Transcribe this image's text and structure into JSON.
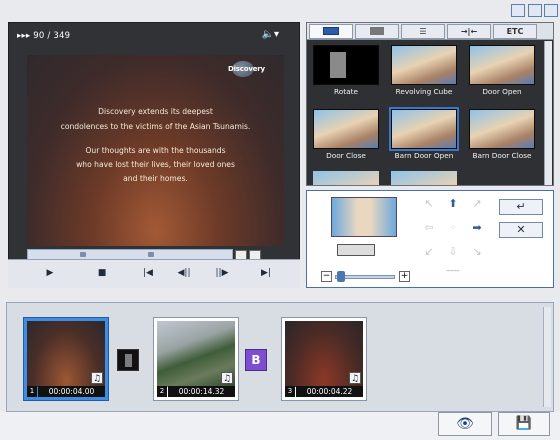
{
  "preview": {
    "frame_counter": "▸▸▸ 90 / 349",
    "video_lines": [
      "Discovery extends its deepest",
      "condolences to the victims of the Asian Tsunamis.",
      "Our thoughts are with the thousands",
      "who have lost their lives, their loved ones",
      "and their homes."
    ],
    "logo_text": "Discovery"
  },
  "effects": {
    "tabs": [
      "",
      "",
      "",
      "",
      "ETC"
    ],
    "items": [
      {
        "label": "Rotate",
        "thumb": "black"
      },
      {
        "label": "Revolving Cube",
        "thumb": "photo"
      },
      {
        "label": "Door Open",
        "thumb": "photo"
      },
      {
        "label": "Door Close",
        "thumb": "photo"
      },
      {
        "label": "Barn Door Open",
        "thumb": "photo-selected"
      },
      {
        "label": "Barn Door Close",
        "thumb": "photo"
      }
    ]
  },
  "storyboard": {
    "clips": [
      {
        "index": "1",
        "duration": "00:00:04.00"
      },
      {
        "index": "2",
        "duration": "00:00:14.32"
      },
      {
        "index": "3",
        "duration": "00:00:04.22"
      }
    ],
    "transition_b_label": "B"
  },
  "colors": {
    "accent": "#3a76c9",
    "panel_dark": "#2f3033"
  }
}
